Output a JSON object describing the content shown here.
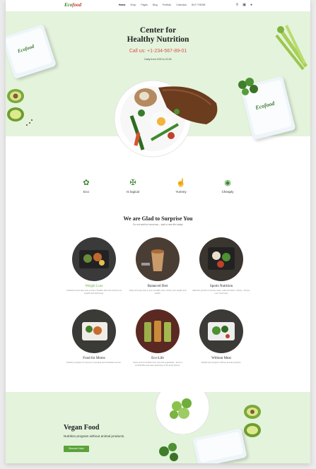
{
  "header": {
    "logo_left": "Eco",
    "logo_right": "food",
    "nav": [
      "Home",
      "Shop",
      "Pages",
      "Blog",
      "Portfolio",
      "Collection",
      "BUY THEME"
    ],
    "icons": [
      "search-icon",
      "cart-icon",
      "user-icon"
    ]
  },
  "hero": {
    "title_line1": "Center for",
    "title_line2": "Healthy Nutrition",
    "call": "Call us: +1-234-567-89-01",
    "daily": "Daily from 9:00 to 21:00",
    "box_brand": "Ecofood"
  },
  "features": [
    {
      "label": "Eco",
      "icon": "leaf-icon"
    },
    {
      "label": "Is logical",
      "icon": "fork-knife-icon"
    },
    {
      "label": "Yummy",
      "icon": "thumbs-up-icon"
    },
    {
      "label": "Cheaply",
      "icon": "money-icon"
    }
  ],
  "surprise": {
    "title": "We are Glad to Surprise You",
    "subtitle": "Do not wait for tomorrow – start a new life today!"
  },
  "cards": [
    {
      "title": "Weight Loss",
      "desc": "A delicious and easy way to lose a healthy diet and control your weight and well-being.",
      "highlight": true
    },
    {
      "title": "Balanced Diet",
      "desc": "Tasty and easy way to join a healthy diet, control your weight and health.",
      "highlight": false
    },
    {
      "title": "Sports Nutrition",
      "desc": "Effective growth of muscle mass, relief formation, drying - choose your new body!",
      "highlight": false
    },
    {
      "title": "Food for Moms",
      "desc": "Nutrition program for women in pending and breastfed women.",
      "highlight": false
    },
    {
      "title": "Eco-Life",
      "desc": "Juices and smoothies from fruit and vegetables - all for a comfortable and easy cleansing of the body (detox).",
      "highlight": false
    },
    {
      "title": "Without Meat",
      "desc": "Weight loss program without animal products.",
      "highlight": false
    }
  ],
  "vegan": {
    "title": "Vegan Food",
    "subtitle": "Nutrition program without animal products.",
    "button": "Discover Now!"
  },
  "colors": {
    "accent": "#5aa23a",
    "hero_bg": "#e4f3dc",
    "call": "#d9534f"
  }
}
